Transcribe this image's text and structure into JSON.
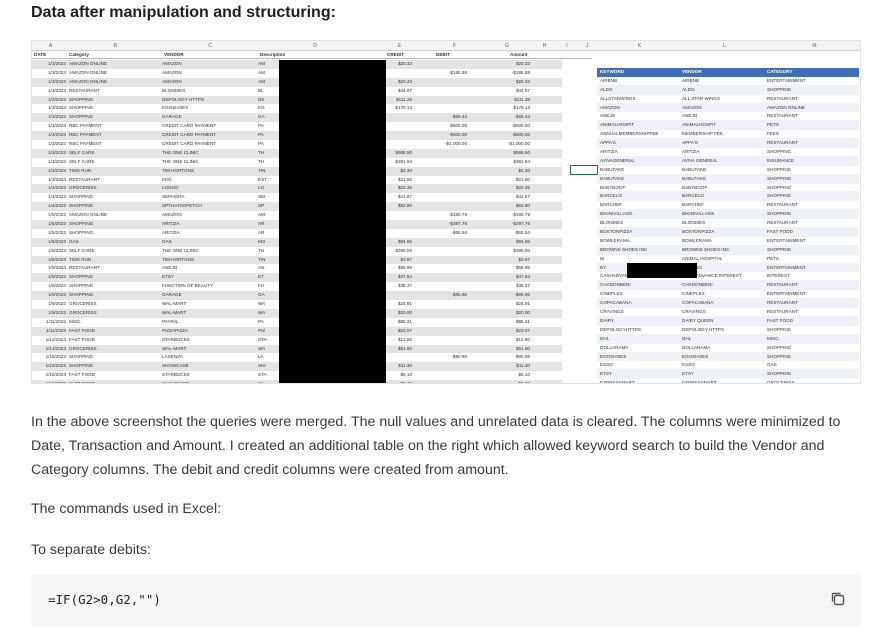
{
  "heading": "Data after manipulation and structuring:",
  "sheet": {
    "col_letters": [
      "A",
      "B",
      "C",
      "D",
      "E",
      "F",
      "G",
      "H",
      "I",
      "J",
      "K",
      "L",
      "M"
    ],
    "headers": {
      "date": "DATE",
      "category": "Category",
      "vendor": "VENDOR",
      "description": "Description",
      "credit": "CREDIT",
      "debit": "DEBIT",
      "amount": "Amount"
    },
    "rows": [
      {
        "date": "1/3/2023",
        "category": "AMAZON ONLINE",
        "vendor": "AMAZON",
        "desc": "AM",
        "credit": "$20.33",
        "debit": "",
        "amount": "$20.33"
      },
      {
        "date": "1/3/2023",
        "category": "AMAZON ONLINE",
        "vendor": "AMAZON",
        "desc": "AM",
        "credit": "",
        "debit": "-$185.88",
        "amount": "-$185.88"
      },
      {
        "date": "1/3/2023",
        "category": "AMAZON ONLINE",
        "vendor": "AMAZON",
        "desc": "AM",
        "credit": "$20.33",
        "debit": "",
        "amount": "$20.33"
      },
      {
        "date": "1/3/2023",
        "category": "RESTAURANT",
        "vendor": "BLONDIES",
        "desc": "BL",
        "credit": "$44.07",
        "debit": "",
        "amount": "$44.07"
      },
      {
        "date": "1/3/2023",
        "category": "SHOPPING",
        "vendor": "DEPOLOGY HTTPS",
        "desc": "DE",
        "credit": "$111.28",
        "debit": "",
        "amount": "$111.28"
      },
      {
        "date": "1/3/2023",
        "category": "SHOPPING",
        "vendor": "EGOSHOES",
        "desc": "EG",
        "credit": "$179.13",
        "debit": "",
        "amount": "$179.13"
      },
      {
        "date": "1/3/2023",
        "category": "SHOPPING",
        "vendor": "GARAGE",
        "desc": "GA",
        "credit": "",
        "debit": "-$56.44",
        "amount": "-$56.44"
      },
      {
        "date": "1/3/2023",
        "category": "RBC PAYMENT",
        "vendor": "CREDIT CARD PAYMENT",
        "desc": "PA",
        "credit": "",
        "debit": "-$500.00",
        "amount": "-$500.00"
      },
      {
        "date": "1/3/2023",
        "category": "RBC PAYMENT",
        "vendor": "CREDIT CARD PAYMENT",
        "desc": "PA",
        "credit": "",
        "debit": "-$500.00",
        "amount": "-$500.00"
      },
      {
        "date": "1/3/2023",
        "category": "RBC PAYMENT",
        "vendor": "CREDIT CARD PAYMENT",
        "desc": "PA",
        "credit": "",
        "debit": "-$1,000.00",
        "amount": "-$1,000.00"
      },
      {
        "date": "1/3/2023",
        "category": "SELF CARE",
        "vendor": "THE ONE CLINIC",
        "desc": "TH",
        "credit": "$988.50",
        "debit": "",
        "amount": "$988.50"
      },
      {
        "date": "1/3/2023",
        "category": "SELF CARE",
        "vendor": "THE ONE CLINIC",
        "desc": "TH",
        "credit": "$381.94",
        "debit": "",
        "amount": "$381.94"
      },
      {
        "date": "1/3/2023",
        "category": "TIMS RUN",
        "vendor": "TIM HORTONS",
        "desc": "TIN",
        "credit": "$2.30",
        "debit": "",
        "amount": "$2.30"
      },
      {
        "date": "1/3/2023",
        "category": "RESTAURANT",
        "vendor": "KEG",
        "desc": "EST",
        "credit": "$21.60",
        "debit": "",
        "amount": "$21.60"
      },
      {
        "date": "1/4/2023",
        "category": "GROCERIES",
        "vendor": "LONGO",
        "desc": "LO",
        "credit": "$22.35",
        "debit": "",
        "amount": "$22.35"
      },
      {
        "date": "1/4/2023",
        "category": "SHOPPING",
        "vendor": "SEPHORA",
        "desc": "SEI",
        "credit": "$41.87",
        "debit": "",
        "amount": "$41.87"
      },
      {
        "date": "1/4/2023",
        "category": "SHOPPING",
        "vendor": "SPTHATSOFETCH",
        "desc": "SP",
        "credit": "$62.80",
        "debit": "",
        "amount": "$62.80"
      },
      {
        "date": "1/5/2023",
        "category": "AMAZON ONLINE",
        "vendor": "AMAZON",
        "desc": "AM",
        "credit": "",
        "debit": "-$180.79",
        "amount": "-$180.79"
      },
      {
        "date": "1/5/2023",
        "category": "SHOPPING",
        "vendor": "ARITZIA",
        "desc": "AR",
        "credit": "",
        "debit": "-$397.76",
        "amount": "-$397.76"
      },
      {
        "date": "1/5/2023",
        "category": "SHOPPING",
        "vendor": "ARITZIA",
        "desc": "AR",
        "credit": "",
        "debit": "-$65.54",
        "amount": "-$65.54"
      },
      {
        "date": "1/5/2023",
        "category": "GAS",
        "vendor": "GAS",
        "desc": "KEI",
        "credit": "$94.65",
        "debit": "",
        "amount": "$94.65"
      },
      {
        "date": "1/5/2023",
        "category": "SELF CARE",
        "vendor": "THE ONE CLINIC",
        "desc": "TH",
        "credit": "$395.00",
        "debit": "",
        "amount": "$395.00"
      },
      {
        "date": "1/6/2023",
        "category": "TIMS RUN",
        "vendor": "TIM HORTONS",
        "desc": "TIN",
        "credit": "$3.97",
        "debit": "",
        "amount": "$3.97"
      },
      {
        "date": "1/9/2023",
        "category": "RESTAURANT",
        "vendor": "ANEJO",
        "desc": "AN",
        "credit": "$58.99",
        "debit": "",
        "amount": "$58.99"
      },
      {
        "date": "1/9/2023",
        "category": "SHOPPING",
        "vendor": "ETSY",
        "desc": "ET",
        "credit": "$47.84",
        "debit": "",
        "amount": "$47.84"
      },
      {
        "date": "1/9/2023",
        "category": "SHOPPING",
        "vendor": "FUNCTION OF BEAUTY",
        "desc": "FU",
        "credit": "$35.37",
        "debit": "",
        "amount": "$35.37"
      },
      {
        "date": "1/9/2023",
        "category": "SHOPPING",
        "vendor": "GARAGE",
        "desc": "GA",
        "credit": "",
        "debit": "-$85.96",
        "amount": "-$85.96"
      },
      {
        "date": "1/9/2023",
        "category": "GROCERIES",
        "vendor": "WAL-MART",
        "desc": "WA",
        "credit": "$24.91",
        "debit": "",
        "amount": "$24.91"
      },
      {
        "date": "1/9/2023",
        "category": "GROCERIES",
        "vendor": "WAL-MART",
        "desc": "WA",
        "credit": "$20.00",
        "debit": "",
        "amount": "$20.00"
      },
      {
        "date": "1/11/2023",
        "category": "MISC.",
        "vendor": "PAYPAL",
        "desc": "PA",
        "credit": "$85.31",
        "debit": "",
        "amount": "$85.31"
      },
      {
        "date": "1/11/2023",
        "category": "FAST FOOD",
        "vendor": "PIZZAPIZZA",
        "desc": "PIZ",
        "credit": "$23.07",
        "debit": "",
        "amount": "$23.07"
      },
      {
        "date": "1/12/2023",
        "category": "FAST FOOD",
        "vendor": "STARBUCKS",
        "desc": "STA",
        "credit": "$12.60",
        "debit": "",
        "amount": "$12.60"
      },
      {
        "date": "1/13/2023",
        "category": "GROCERIES",
        "vendor": "WAL-MART",
        "desc": "WA",
        "credit": "$51.60",
        "debit": "",
        "amount": "$51.60"
      },
      {
        "date": "1/16/2023",
        "category": "SHOPPING",
        "vendor": "LASENZA",
        "desc": "LA",
        "credit": "",
        "debit": "-$90.68",
        "amount": "-$90.68"
      },
      {
        "date": "1/16/2023",
        "category": "SHOPPING",
        "vendor": "SHOWCASE",
        "desc": "SHI",
        "credit": "$11.30",
        "debit": "",
        "amount": "$11.30"
      },
      {
        "date": "1/16/2023",
        "category": "FAST FOOD",
        "vendor": "STARBUCKS",
        "desc": "STA",
        "credit": "$6.10",
        "debit": "",
        "amount": "$6.10"
      },
      {
        "date": "1/16/2023",
        "category": "FAST FOOD",
        "vendor": "SUSHISHOP",
        "desc": "SU",
        "credit": "$5.72",
        "debit": "",
        "amount": "$5.72"
      }
    ],
    "lookup": {
      "headers": {
        "keyword": "KEYWORD",
        "vendor": "VENDOR",
        "category": "CATEGORY"
      },
      "rows": [
        {
          "k": "AIRBNB",
          "v": "AIRBNB",
          "c": "ENTERTAINMENT"
        },
        {
          "k": "ALDO",
          "v": "ALDO",
          "c": "SHOPPING"
        },
        {
          "k": "ALLSTARWINGS",
          "v": "ALL STAR WINGS",
          "c": "RESTAURANT"
        },
        {
          "k": "AMAZON",
          "v": "AMAZON",
          "c": "AMAZON ONLINE"
        },
        {
          "k": "ANEJO",
          "v": "ANEJO",
          "c": "RESTAURANT"
        },
        {
          "k": "ANIMALHOSPIT",
          "v": "ANIMALHOSPIT",
          "c": "PETS"
        },
        {
          "k": "ANNUALMEMBERSHIPFEE",
          "v": "MEMBERSHIP FEE",
          "c": "FEES"
        },
        {
          "k": "APPA'S",
          "v": "APPA'S",
          "c": "RESTAURANT"
        },
        {
          "k": "ARITZIA",
          "v": "ARITZIA",
          "c": "SHOPPING"
        },
        {
          "k": "AVIVAGENERAL",
          "v": "AVIVA GENERAL",
          "c": "INSURANCE"
        },
        {
          "k": "BABUTAKE",
          "v": "BABUTAKE",
          "c": "SHOPPING"
        },
        {
          "k": "BABUTAKE",
          "v": "BABUTAKE",
          "c": "SHOPPING"
        },
        {
          "k": "BABYBOOF",
          "v": "BABYBOOF",
          "c": "SHOPPING"
        },
        {
          "k": "BARCELO",
          "v": "BARCELO",
          "c": "SHOPPING"
        },
        {
          "k": "BARCHEF",
          "v": "BARCHEF",
          "c": "RESTAURANT"
        },
        {
          "k": "BIKINIVILLAGE",
          "v": "BIKINIVILLAGE",
          "c": "SHOPPING"
        },
        {
          "k": "BLONDIES",
          "v": "BLONDIES",
          "c": "RESTAURANT"
        },
        {
          "k": "BOSTONPIZZA",
          "v": "BOSTONPIZZA",
          "c": "FAST FOOD"
        },
        {
          "k": "BOWLERAMA",
          "v": "BOWLERAMA",
          "c": "ENTERTAINMENT"
        },
        {
          "k": "BROWNS SHOES INC",
          "v": "BROWNS SHOES INC",
          "c": "SHOPPING"
        },
        {
          "k": "BI",
          "v": "ANIMAL HOSPITAL",
          "c": "PETS"
        },
        {
          "k": "BY",
          "v": "BYOUNG",
          "c": "ENTERTAINMENT"
        },
        {
          "k": "CASHADVANCE",
          "v": "CASH ADVANCE INTEREST",
          "c": "INTEREST"
        },
        {
          "k": "CHADONBENI",
          "v": "CHADONBENI",
          "c": "RESTAURANT"
        },
        {
          "k": "CINEPLEX",
          "v": "CINEPLEX",
          "c": "ENTERTAINMENT"
        },
        {
          "k": "COPACABANA",
          "v": "COPACABANA",
          "c": "RESTAURANT"
        },
        {
          "k": "CRAVINGS",
          "v": "CRAVINGS",
          "c": "RESTAURANT"
        },
        {
          "k": "DAIRY",
          "v": "DAIRY QUEEN",
          "c": "FAST FOOD"
        },
        {
          "k": "DEPOLOGYHTTPS",
          "v": "DEPOLOGY HTTPS",
          "c": "SHOPPING"
        },
        {
          "k": "DHL",
          "v": "DHL",
          "c": "MISC."
        },
        {
          "k": "DOLLARAMA",
          "v": "DOLLARAMA",
          "c": "SHOPPING"
        },
        {
          "k": "EGOSHOES",
          "v": "EGOSHOES",
          "c": "SHOPPING"
        },
        {
          "k": "ESSO",
          "v": "ESSO",
          "c": "GAS"
        },
        {
          "k": "ETSY",
          "v": "ETSY",
          "c": "SHOPPING"
        },
        {
          "k": "EXPRESSMART",
          "v": "EXPRESSMART",
          "c": "GROCERIES"
        }
      ]
    }
  },
  "paragraph1": "In the above screenshot the queries were merged. The null values and unrelated data is cleared. The columns were minimized to Date, Transaction and Amount. I created an additional table on the right which allowed keyword search to build the Vendor and Category columns. The debit and credit columns were created from amount.",
  "paragraph2": "The commands used in Excel:",
  "paragraph3": "To separate debits:",
  "code": "=IF(G2>0,G2,\"\")",
  "copy_icon": "copy-icon"
}
